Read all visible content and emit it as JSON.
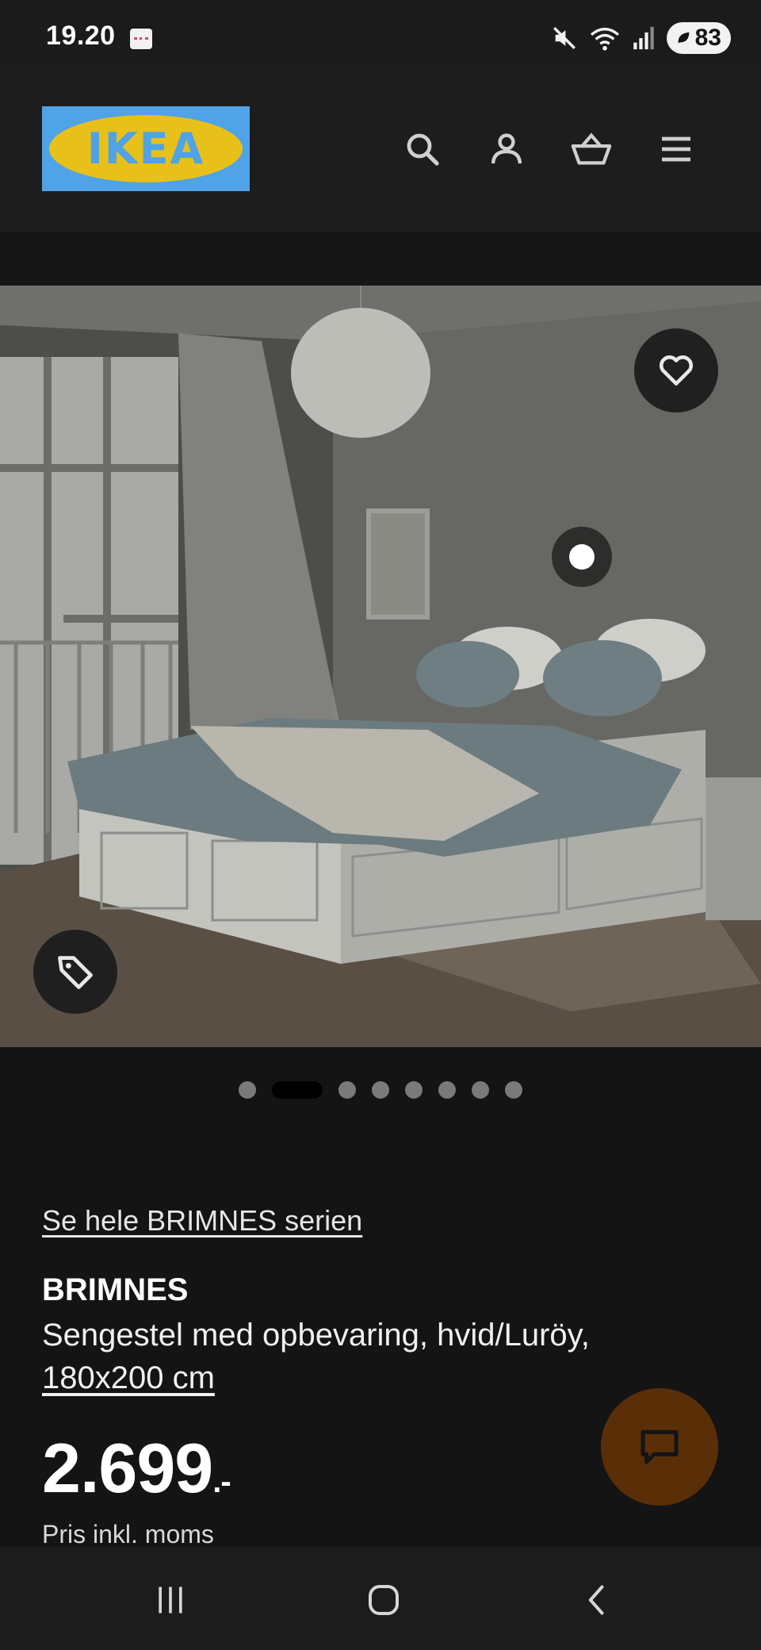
{
  "status_bar": {
    "time": "19.20",
    "battery": "83",
    "icons": [
      "mute-icon",
      "wifi-icon",
      "signal-icon",
      "battery-icon"
    ]
  },
  "header": {
    "logo_text": "IKEA",
    "icons": [
      "search-icon",
      "account-icon",
      "basket-icon",
      "menu-icon"
    ]
  },
  "hero": {
    "favorite_icon": "heart-icon",
    "tag_icon": "price-tag-icon",
    "carousel": {
      "count": 8,
      "active_index": 1
    }
  },
  "product": {
    "series_link": "Se hele BRIMNES serien",
    "name": "BRIMNES",
    "description": "Sengestel med opbevaring, hvid/Luröy,",
    "size": "180x200 cm",
    "price": "2.699",
    "price_suffix": ".-",
    "price_note": "Pris inkl. moms"
  },
  "chat": {
    "icon": "chat-icon"
  },
  "nav_bar": {
    "icons": [
      "recent-apps-icon",
      "home-icon",
      "back-icon"
    ]
  },
  "colors": {
    "background": "#141414",
    "logo_blue": "#4fa3e6",
    "logo_yellow": "#e8c01a",
    "chat_button": "#5a2f08"
  }
}
